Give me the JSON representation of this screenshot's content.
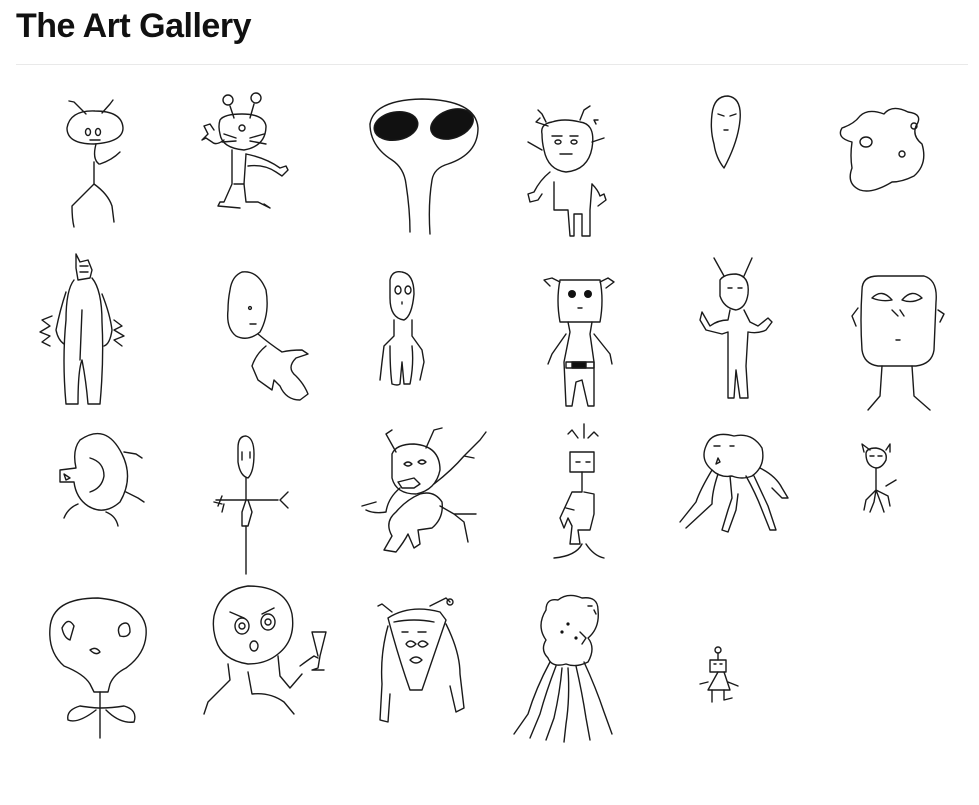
{
  "page": {
    "title": "The Art Gallery"
  },
  "gallery": {
    "drawings": [
      {
        "icon": "antenna-alien-drawing"
      },
      {
        "icon": "cat-alien-waving-drawing"
      },
      {
        "icon": "big-eyed-grey-alien-drawing"
      },
      {
        "icon": "pointy-eared-alien-drawing"
      },
      {
        "icon": "teardrop-face-drawing"
      },
      {
        "icon": "blob-drawing"
      },
      {
        "icon": "tall-robot-alien-drawing"
      },
      {
        "icon": "floating-alien-drawing"
      },
      {
        "icon": "thin-alien-drawing"
      },
      {
        "icon": "eared-alien-with-belt-drawing"
      },
      {
        "icon": "antenna-alien-arms-up-drawing"
      },
      {
        "icon": "big-head-face-drawing"
      },
      {
        "icon": "round-head-alien-drawing"
      },
      {
        "icon": "stick-alien-drawing"
      },
      {
        "icon": "bug-alien-drawing"
      },
      {
        "icon": "tree-alien-drawing"
      },
      {
        "icon": "octopus-alien-drawing"
      },
      {
        "icon": "small-horned-alien-drawing"
      },
      {
        "icon": "skull-alien-drawing"
      },
      {
        "icon": "alien-with-glass-drawing"
      },
      {
        "icon": "triangle-face-alien-drawing"
      },
      {
        "icon": "jellyfish-alien-drawing"
      },
      {
        "icon": "tiny-robot-drawing"
      }
    ]
  },
  "colors": {
    "background": "#ffffff",
    "ink": "#1a1a1a",
    "divider": "#e9e9e9"
  }
}
